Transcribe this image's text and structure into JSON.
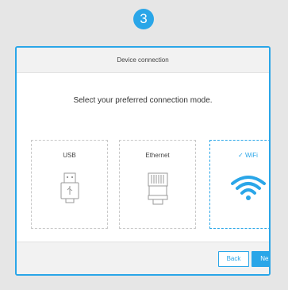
{
  "step": {
    "number": "3"
  },
  "dialog": {
    "title": "Device connection",
    "prompt": "Select your preferred connection mode.",
    "options": [
      {
        "label": "USB",
        "icon": "usb-icon",
        "selected": false
      },
      {
        "label": "Ethernet",
        "icon": "ethernet-icon",
        "selected": false
      },
      {
        "label": "WiFi",
        "icon": "wifi-icon",
        "selected": true,
        "check": "✓"
      }
    ],
    "buttons": {
      "back": "Back",
      "next": "Next"
    }
  },
  "colors": {
    "accent": "#2aa6e8",
    "background": "#e6e6e6"
  }
}
